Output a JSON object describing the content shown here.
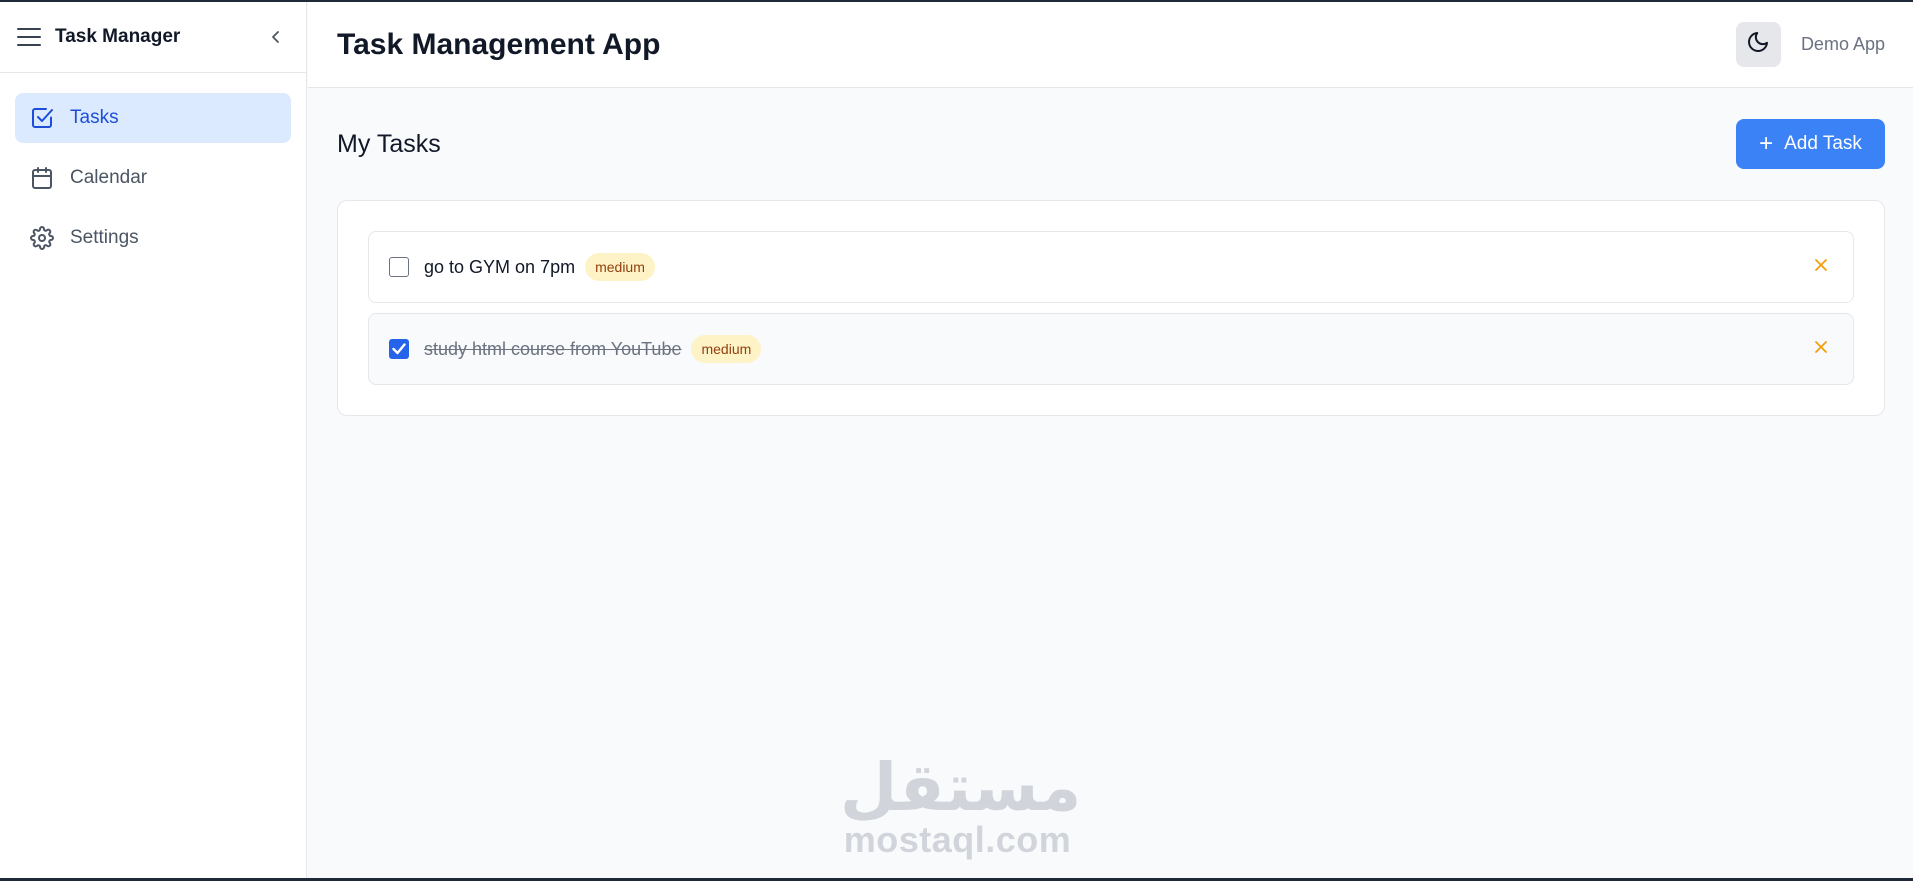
{
  "sidebar": {
    "title": "Task Manager",
    "items": [
      {
        "label": "Tasks",
        "icon": "check-square-icon",
        "active": true
      },
      {
        "label": "Calendar",
        "icon": "calendar-icon",
        "active": false
      },
      {
        "label": "Settings",
        "icon": "gear-icon",
        "active": false
      }
    ]
  },
  "header": {
    "title": "Task Management App",
    "demo_label": "Demo App",
    "theme_icon": "moon-icon"
  },
  "main": {
    "section_title": "My Tasks",
    "add_button_label": "Add Task",
    "tasks": [
      {
        "text": "go to GYM on 7pm",
        "priority": "medium",
        "completed": false
      },
      {
        "text": "study html course from YouTube",
        "priority": "medium",
        "completed": true
      }
    ]
  },
  "watermark": {
    "arabic": "مستقل",
    "latin": "mostaql.com"
  },
  "colors": {
    "accent": "#3b82f6",
    "active_nav_bg": "#dbeafe",
    "badge_bg": "#fef3c7",
    "badge_text": "#92400e",
    "delete_icon": "#f59e0b"
  }
}
